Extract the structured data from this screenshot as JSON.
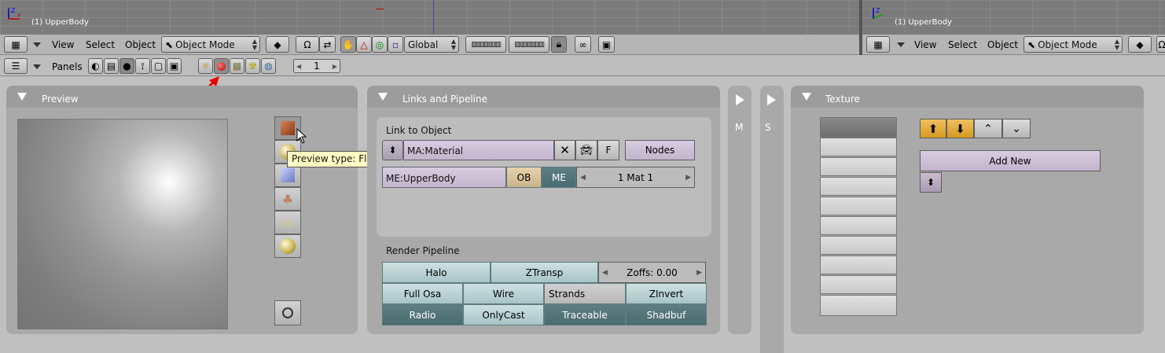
{
  "left_view": {
    "label": "(1) UpperBody"
  },
  "right_view": {
    "label": "(1) UpperBody"
  },
  "view_header": {
    "menus": [
      "View",
      "Select",
      "Object"
    ],
    "mode": "Object Mode",
    "orientation": "Global"
  },
  "right_header": {
    "menus": [
      "View",
      "Select",
      "Object"
    ],
    "mode": "Object Mode"
  },
  "buttons_header": {
    "panels_label": "Panels",
    "frame": "1"
  },
  "preview": {
    "title": "Preview",
    "tooltip": "Preview type: Flat XY plane"
  },
  "links": {
    "title": "Links and Pipeline",
    "link_to_object": "Link to Object",
    "material": "MA:Material",
    "f_label": "F",
    "nodes": "Nodes",
    "mesh": "ME:UpperBody",
    "ob": "OB",
    "me": "ME",
    "mat_count": "1 Mat 1",
    "render_pipeline": "Render Pipeline",
    "pipeline_buttons": {
      "halo": "Halo",
      "ztransp": "ZTransp",
      "zoffs": "Zoffs: 0.00",
      "full_osa": "Full Osa",
      "wire": "Wire",
      "strands": "Strands",
      "zinvert": "ZInvert",
      "radio": "Radio",
      "onlycast": "OnlyCast",
      "traceable": "Traceable",
      "shadbuf": "Shadbuf"
    }
  },
  "tab_m": {
    "label": "M"
  },
  "tab_s": {
    "label": "S"
  },
  "texture": {
    "title": "Texture",
    "add_new": "Add New"
  }
}
